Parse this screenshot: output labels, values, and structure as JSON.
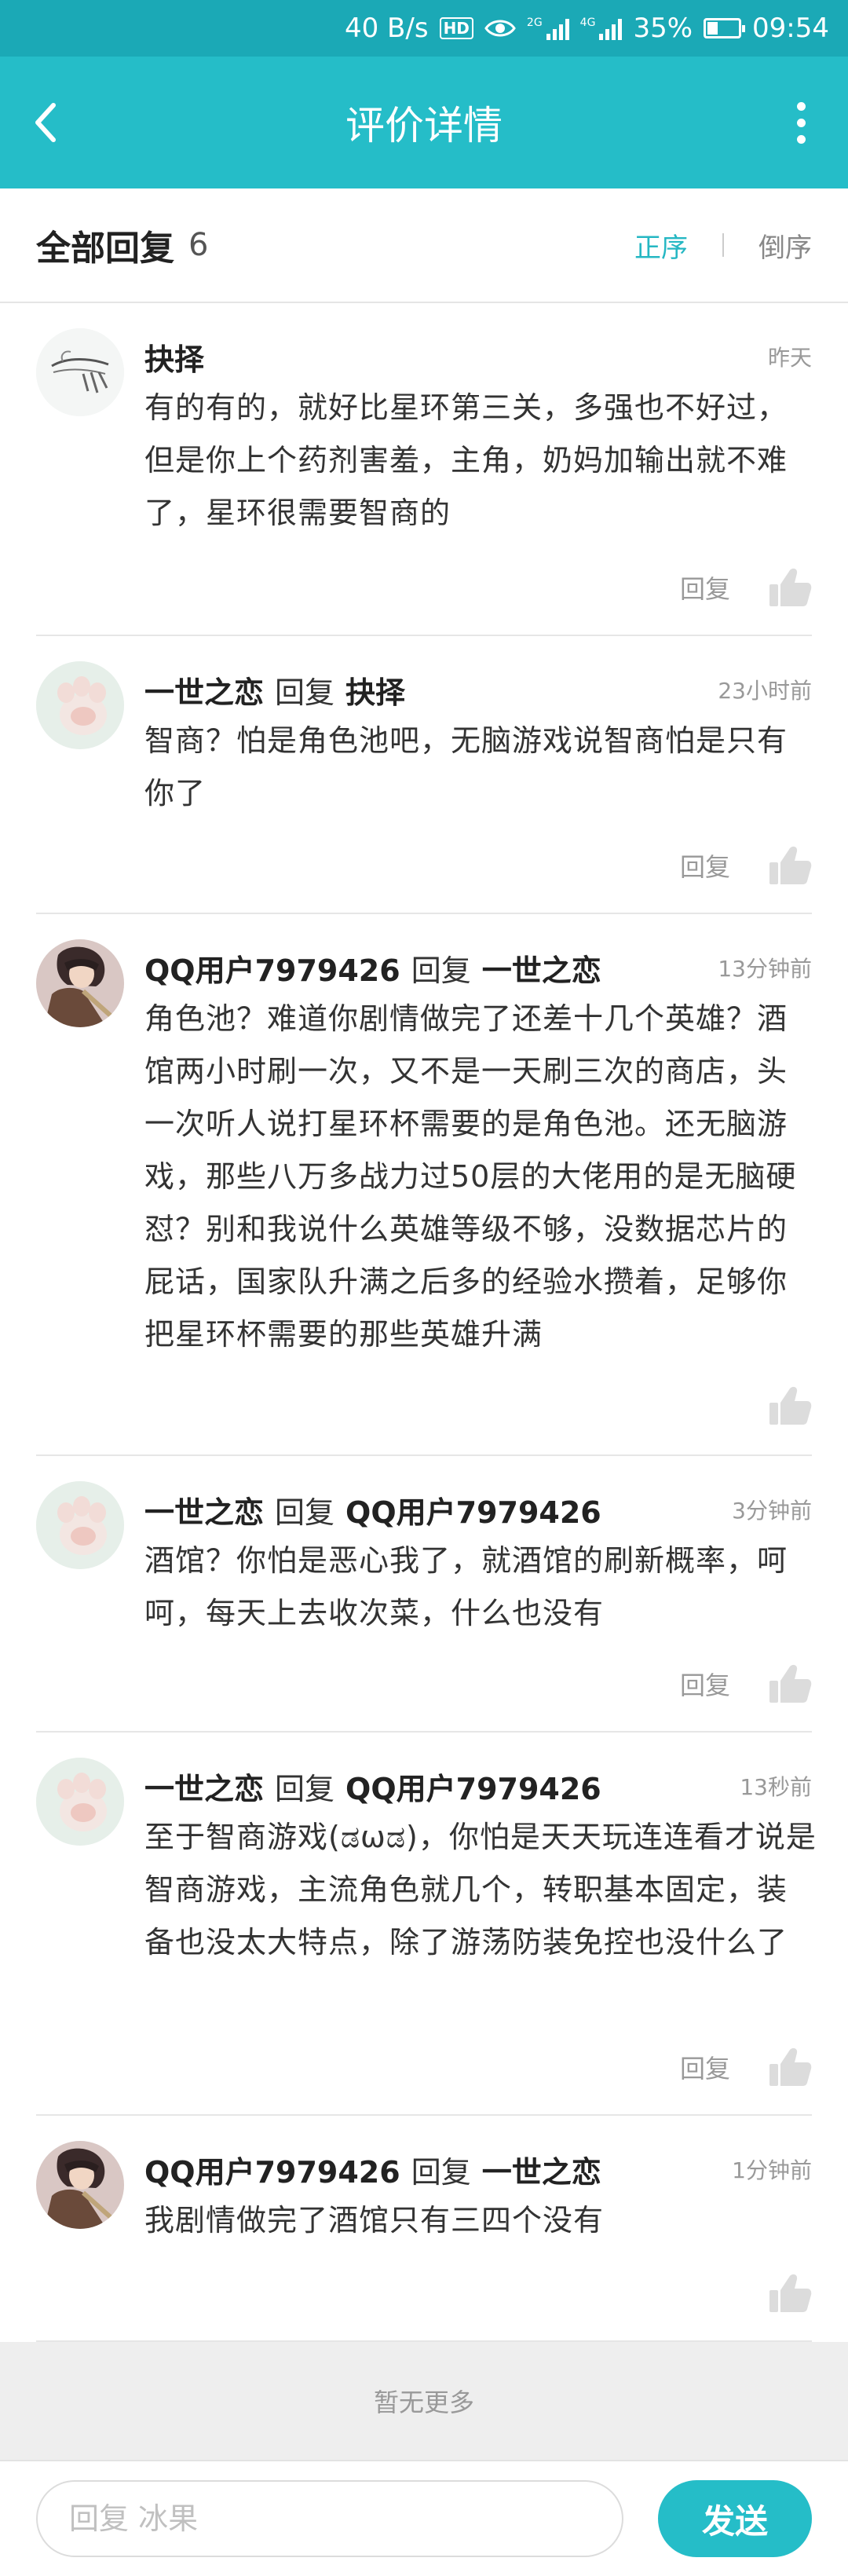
{
  "status_bar": {
    "speed": "40 B/s",
    "hd_badge": "HD",
    "network_1": "2G",
    "network_2": "4G",
    "battery_text": "35%",
    "battery_level": 0.35,
    "time": "09:54",
    "icons": [
      "hd-icon",
      "eye-icon",
      "signal-icon",
      "signal-icon",
      "battery-icon"
    ]
  },
  "app_bar": {
    "title": "评价详情",
    "back_icon": "chevron-left-icon",
    "menu_icon": "more-vertical-icon"
  },
  "header": {
    "title": "全部回复",
    "count": "6",
    "sort_asc": "正序",
    "sort_desc": "倒序"
  },
  "comments": [
    {
      "author": "抉择",
      "reply_word": "",
      "reply_to": "",
      "time": "昨天",
      "text": "有的有的，就好比星环第三关，多强也不好过，但是你上个药剂害羞，主角，奶妈加输出就不难了，星环很需要智商的",
      "reply_label": "回复",
      "avatar": "sketch"
    },
    {
      "author": "一世之恋",
      "reply_word": "回复",
      "reply_to": "抉择",
      "time": "23小时前",
      "text": "智商？怕是角色池吧，无脑游戏说智商怕是只有你了",
      "reply_label": "回复",
      "avatar": "paw"
    },
    {
      "author": "QQ用户7979426",
      "reply_word": "回复",
      "reply_to": "一世之恋",
      "time": "13分钟前",
      "text": "角色池？难道你剧情做完了还差十几个英雄？酒馆两小时刷一次，又不是一天刷三次的商店，头一次听人说打星环杯需要的是角色池。还无脑游戏，那些八万多战力过50层的大佬用的是无脑硬怼？别和我说什么英雄等级不够，没数据芯片的屁话，国家队升满之后多的经验水攒着，足够你把星环杯需要的那些英雄升满",
      "reply_label": "",
      "avatar": "anime"
    },
    {
      "author": "一世之恋",
      "reply_word": "回复",
      "reply_to": "QQ用户7979426",
      "time": "3分钟前",
      "text": "酒馆？你怕是恶心我了，就酒馆的刷新概率，呵呵，每天上去收次菜，什么也没有",
      "reply_label": "回复",
      "avatar": "paw"
    },
    {
      "author": "一世之恋",
      "reply_word": "回复",
      "reply_to": "QQ用户7979426",
      "time": "13秒前",
      "text": "至于智商游戏(ಡωಡ)，你怕是天天玩连连看才说是智商游戏，主流角色就几个，转职基本固定，装备也没太大特点，除了游荡防装免控也没什么了",
      "reply_label": "回复",
      "avatar": "paw"
    },
    {
      "author": "QQ用户7979426",
      "reply_word": "回复",
      "reply_to": "一世之恋",
      "time": "1分钟前",
      "text": "我剧情做完了酒馆只有三四个没有",
      "reply_label": "",
      "avatar": "anime"
    }
  ],
  "footer": {
    "no_more": "暂无更多",
    "input_placeholder": "回复 冰果",
    "send_label": "发送"
  },
  "colors": {
    "status_bar": "#1ba9b6",
    "app_bar": "#25bdc8",
    "accent": "#25b7c3",
    "muted": "#999999"
  }
}
